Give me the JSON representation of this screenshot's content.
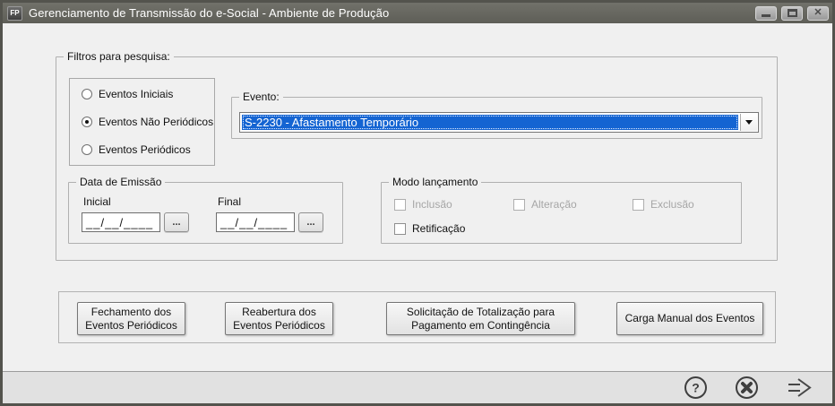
{
  "window": {
    "title": "Gerenciamento de Transmissão do e-Social - Ambiente de Produção",
    "app_icon_text": "FP",
    "controls": {
      "minimize": "minimize",
      "maximize": "maximize",
      "close": "✕"
    }
  },
  "filters": {
    "group_label": "Filtros para pesquisa:",
    "event_types": {
      "options": [
        {
          "label": "Eventos Iniciais",
          "selected": false
        },
        {
          "label": "Eventos Não Periódicos",
          "selected": true
        },
        {
          "label": "Eventos Periódicos",
          "selected": false
        }
      ]
    },
    "event": {
      "group_label": "Evento:",
      "selected_option": "S-2230 - Afastamento Temporário"
    },
    "emission_date": {
      "group_label": "Data de Emissão",
      "initial_label": "Inicial",
      "final_label": "Final",
      "mask": "__/__/____",
      "browse_label": "..."
    },
    "launch_mode": {
      "group_label": "Modo lançamento",
      "checkboxes": [
        {
          "label": "Inclusão",
          "checked": false,
          "disabled": true
        },
        {
          "label": "Alteração",
          "checked": false,
          "disabled": true
        },
        {
          "label": "Exclusão",
          "checked": false,
          "disabled": true
        },
        {
          "label": "Retificação",
          "checked": false,
          "disabled": false
        }
      ]
    }
  },
  "actions": {
    "buttons": [
      "Fechamento dos Eventos Periódicos",
      "Reabertura dos Eventos Periódicos",
      "Solicitação de Totalização para Pagamento em Contingência",
      "Carga Manual dos Eventos"
    ]
  },
  "footer": {
    "help_glyph": "?",
    "icons": [
      "help-icon",
      "cancel-icon",
      "forward-icon"
    ]
  },
  "colors": {
    "selection_blue": "#1464d2",
    "titlebar_gray": "#67675f",
    "body_gray": "#f0f0f0",
    "footer_gray": "#e1e1e1"
  }
}
